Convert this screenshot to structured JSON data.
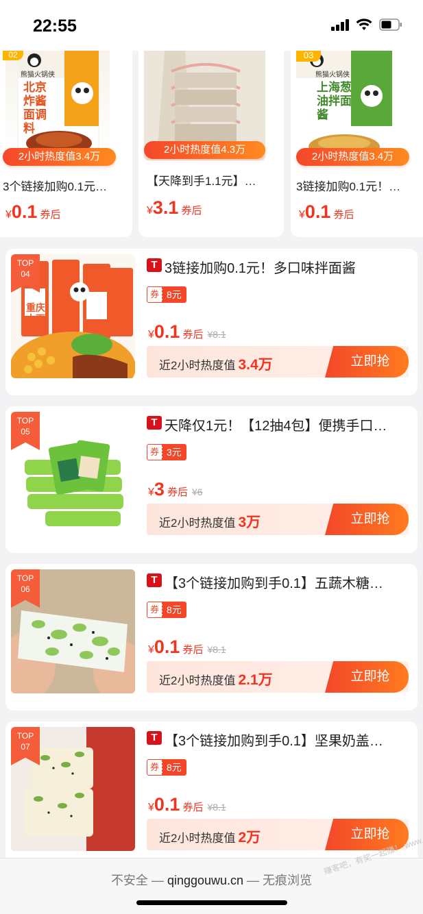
{
  "status": {
    "time": "22:55"
  },
  "top_cards": [
    {
      "rank": "02",
      "heat": "2小时热度值3.4万",
      "title": "3个链接加购0.1元…",
      "yen": "¥",
      "price": "0.1",
      "after": "券后",
      "brand": "熊猫火锅侠",
      "pack_text": "北京炸酱面调料"
    },
    {
      "heat": "2小时热度值4.3万",
      "title": "【天降到手1.1元】…",
      "yen": "¥",
      "price": "3.1",
      "after": "券后"
    },
    {
      "rank": "03",
      "heat": "2小时热度值3.4万",
      "title": "3链接加购0.1元！…",
      "yen": "¥",
      "price": "0.1",
      "after": "券后",
      "brand": "熊猫火锅侠",
      "pack_text": "上海葱油拌面酱"
    }
  ],
  "list_items": [
    {
      "top_label": "TOP",
      "rank": "04",
      "platform": "T",
      "title": "3链接加购0.1元！多口味拌面酱",
      "coupon_label": "券",
      "coupon_value": "8元",
      "yen": "¥",
      "price": "0.1",
      "after": "券后",
      "orig": "¥8.1",
      "heat_label": "近2小时热度值",
      "heat_value": "3.4万",
      "buy": "立即抢",
      "pack_text": "重庆小面调料"
    },
    {
      "top_label": "TOP",
      "rank": "05",
      "platform": "T",
      "title": "天降仅1元！【12抽4包】便携手口…",
      "coupon_label": "券",
      "coupon_value": "3元",
      "yen": "¥",
      "price": "3",
      "after": "券后",
      "orig": "¥6",
      "heat_label": "近2小时热度值",
      "heat_value": "3万",
      "buy": "立即抢"
    },
    {
      "top_label": "TOP",
      "rank": "06",
      "platform": "T",
      "title": "【3个链接加购到手0.1】五蔬木糖…",
      "coupon_label": "券",
      "coupon_value": "8元",
      "yen": "¥",
      "price": "0.1",
      "after": "券后",
      "orig": "¥8.1",
      "heat_label": "近2小时热度值",
      "heat_value": "2.1万",
      "buy": "立即抢"
    },
    {
      "top_label": "TOP",
      "rank": "07",
      "platform": "T",
      "title": "【3个链接加购到手0.1】坚果奶盖…",
      "coupon_label": "券",
      "coupon_value": "8元",
      "yen": "¥",
      "price": "0.1",
      "after": "券后",
      "orig": "¥8.1",
      "heat_label": "近2小时热度值",
      "heat_value": "2万",
      "buy": "立即抢"
    }
  ],
  "browser": {
    "insecure": "不安全 — ",
    "host": "qinggouwu.cn",
    "mode": " — 无痕浏览"
  },
  "watermark": "赚客吧，有奖一起赚！ www.zuanke8.com"
}
